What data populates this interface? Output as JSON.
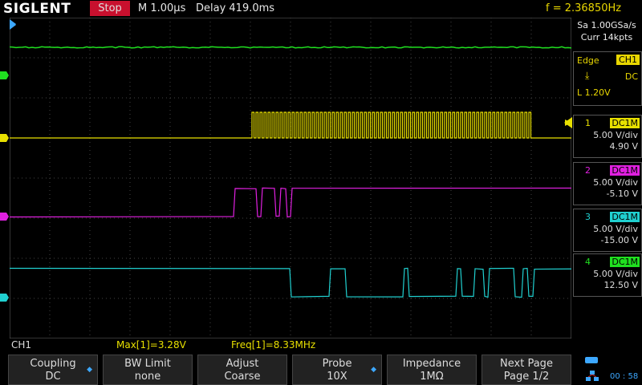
{
  "header": {
    "brand": "SIGLENT",
    "run_state": "Stop",
    "timebase": "M 1.00μs",
    "delay": "Delay 419.0ms",
    "frequency": "f = 2.36850Hz"
  },
  "acquisition": {
    "sample_rate": "Sa 1.00GSa/s",
    "memory": "Curr 14kpts"
  },
  "trigger": {
    "type": "Edge",
    "source": "CH1",
    "coupling": "DC",
    "level": "L  1.20V"
  },
  "channels": [
    {
      "num": "1",
      "coupling": "DC1M",
      "scale": "5.00 V/div",
      "offset": "4.90 V",
      "color": "#e8e000"
    },
    {
      "num": "2",
      "coupling": "DC1M",
      "scale": "5.00 V/div",
      "offset": "-5.10 V",
      "color": "#e020e0"
    },
    {
      "num": "3",
      "coupling": "DC1M",
      "scale": "5.00 V/div",
      "offset": "-15.00 V",
      "color": "#20d0d0"
    },
    {
      "num": "4",
      "coupling": "DC1M",
      "scale": "5.00 V/div",
      "offset": "12.50 V",
      "color": "#20e020"
    }
  ],
  "status": {
    "channel": "CH1",
    "max": "Max[1]=3.28V",
    "freq": "Freq[1]=8.33MHz"
  },
  "softkeys": [
    {
      "line1": "Coupling",
      "line2": "DC",
      "arrow": true
    },
    {
      "line1": "BW Limit",
      "line2": "none",
      "arrow": false
    },
    {
      "line1": "Adjust",
      "line2": "Coarse",
      "arrow": false
    },
    {
      "line1": "Probe",
      "line2": "10X",
      "arrow": true
    },
    {
      "line1": "Impedance",
      "line2": "1MΩ",
      "arrow": false
    },
    {
      "line1": "Next Page",
      "line2": "Page 1/2",
      "arrow": false
    }
  ],
  "clock": "00 : 58",
  "colors": {
    "ch1": "#e8e000",
    "ch2": "#e020e0",
    "ch3": "#20d0d0",
    "ch4": "#20e020",
    "accent": "#3da8ff",
    "stop": "#c8102e"
  }
}
